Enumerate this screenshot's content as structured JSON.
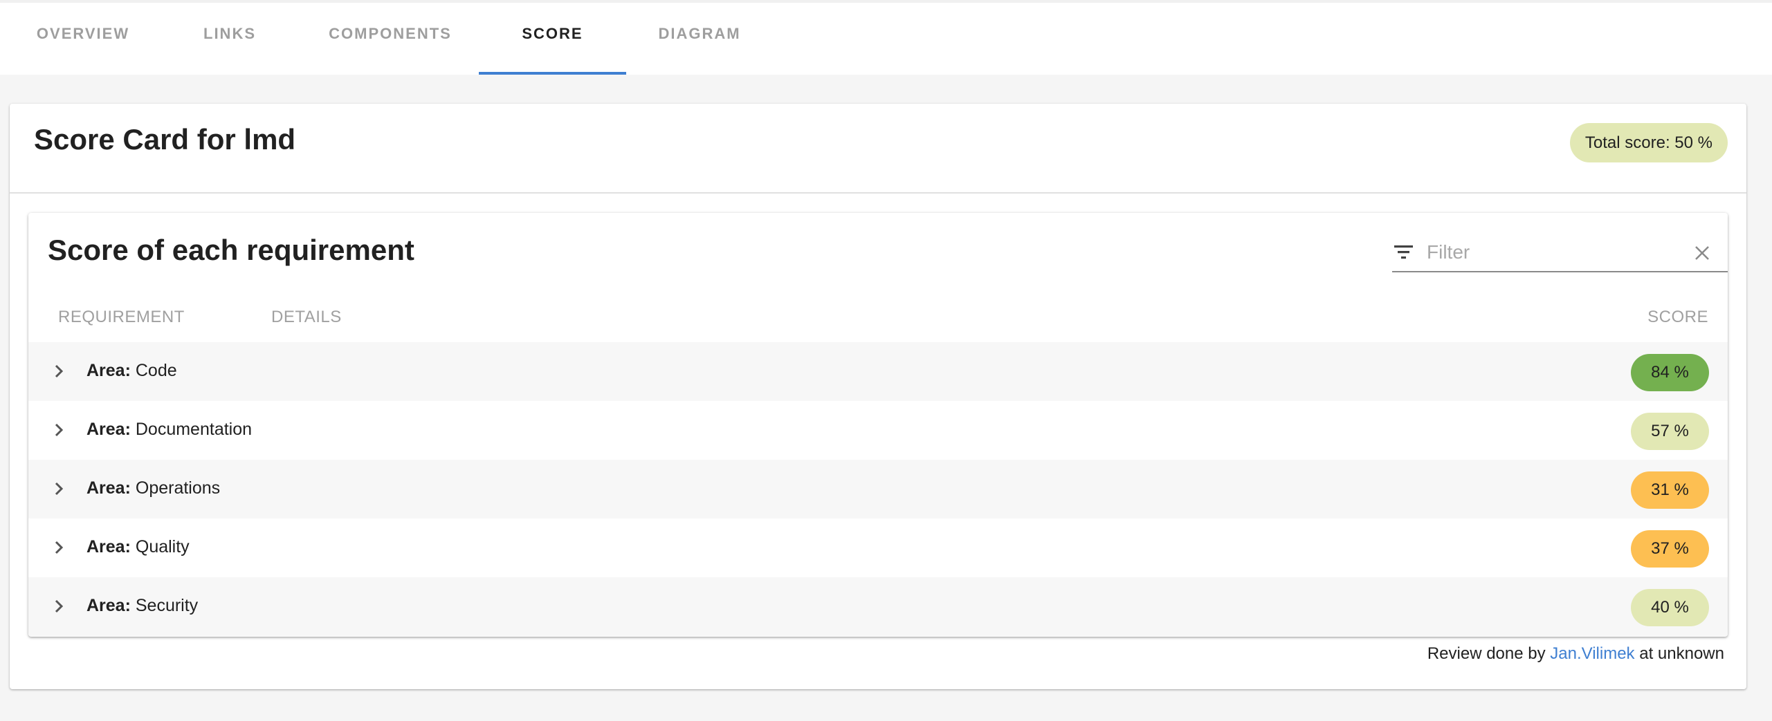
{
  "tabs": [
    {
      "label": "OVERVIEW",
      "active": false
    },
    {
      "label": "LINKS",
      "active": false
    },
    {
      "label": "COMPONENTS",
      "active": false
    },
    {
      "label": "SCORE",
      "active": true
    },
    {
      "label": "DIAGRAM",
      "active": false
    }
  ],
  "card": {
    "title": "Score Card for lmd",
    "total_score_label": "Total score: 50 %",
    "total_score_color": "#e2e8b4"
  },
  "requirements": {
    "title": "Score of each requirement",
    "filter": {
      "placeholder": "Filter",
      "value": "",
      "icon": "filter-list-icon",
      "clear_icon": "close-icon"
    },
    "columns": {
      "requirement": "REQUIREMENT",
      "details": "DETAILS",
      "score": "SCORE"
    },
    "rows": [
      {
        "prefix": "Area:",
        "name": "Code",
        "score": "84 %",
        "color": "#74b04f"
      },
      {
        "prefix": "Area:",
        "name": "Documentation",
        "score": "57 %",
        "color": "#e2e8b4"
      },
      {
        "prefix": "Area:",
        "name": "Operations",
        "score": "31 %",
        "color": "#fdbf52"
      },
      {
        "prefix": "Area:",
        "name": "Quality",
        "score": "37 %",
        "color": "#fdbf52"
      },
      {
        "prefix": "Area:",
        "name": "Security",
        "score": "40 %",
        "color": "#e2e8b4"
      }
    ]
  },
  "review": {
    "prefix": "Review done by",
    "reviewer": "Jan.Vilimek",
    "suffix": "at unknown"
  }
}
